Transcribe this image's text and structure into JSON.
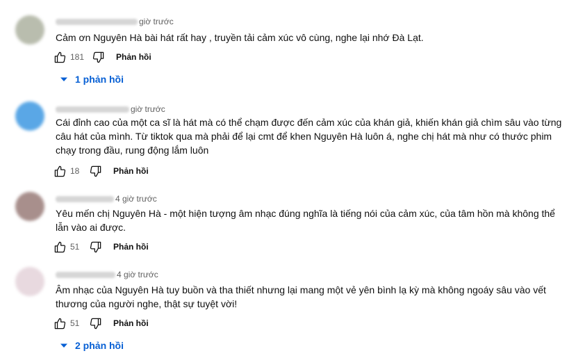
{
  "icons": {
    "like": "like-icon",
    "dislike": "dislike-icon",
    "expand": "chevron-down-icon"
  },
  "colors": {
    "link": "#065fd4",
    "muted": "#606060"
  },
  "comments": [
    {
      "time": "giờ trước",
      "text": "Cảm ơn Nguyên Hà bài hát rất hay , truyền tải cảm xúc vô cùng, nghe lại nhớ Đà Lạt.",
      "likes": "181",
      "reply_label": "Phản hồi",
      "replies_label": "1 phản hồi",
      "avatar_color": "#b9bdae"
    },
    {
      "time": "giờ trước",
      "text": "Cái đỉnh cao của một ca sĩ là hát mà có thể chạm được đến cảm xúc của khán giả, khiến khán giả chìm sâu vào từng câu hát của mình. Từ tiktok qua mà phải để lại cmt để khen Nguyên Hà luôn á, nghe chị hát mà như có thước phim chạy trong đầu, rung động lắm luôn",
      "likes": "18",
      "reply_label": "Phản hồi",
      "replies_label": "",
      "avatar_color": "#5aa7e6"
    },
    {
      "time": "4 giờ trước",
      "text": "Yêu mến chị Nguyên Hà - một hiện tượng âm nhạc đúng nghĩa là tiếng nói của cảm xúc, của tâm hồn mà không thể lẫn vào ai được.",
      "likes": "51",
      "reply_label": "Phản hồi",
      "replies_label": "",
      "avatar_color": "#a88f8c"
    },
    {
      "time": "4 giờ trước",
      "text": "Âm nhạc của Nguyên Hà tuy buồn và tha thiết nhưng lại mang một vẻ yên bình lạ kỳ mà không ngoáy sâu vào vết thương của người nghe, thật sự tuyệt vời!",
      "likes": "51",
      "reply_label": "Phản hồi",
      "replies_label": "2 phản hồi",
      "avatar_color": "#e8d9df"
    }
  ]
}
